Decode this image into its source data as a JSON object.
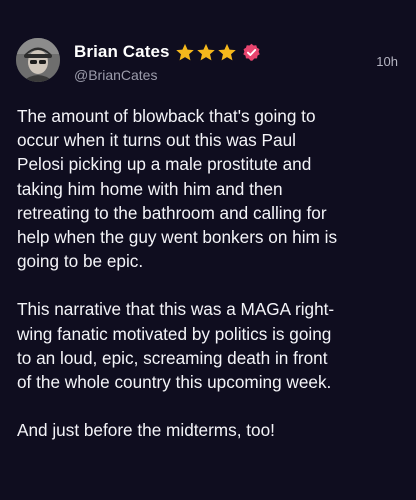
{
  "post": {
    "author": {
      "display_name": "Brian Cates",
      "handle": "@BrianCates",
      "stars_count": 3,
      "star_color": "#f5b81c",
      "verified_color": "#e8456f"
    },
    "timestamp": "10h",
    "paragraphs": [
      "The amount of blowback that's going to\noccur when it turns out this was Paul\nPelosi picking up a male prostitute and\ntaking him home with him and then\nretreating to the bathroom and calling for\nhelp when the guy went bonkers on him is\ngoing to be epic.",
      "This narrative that this was a MAGA right-\nwing fanatic motivated by politics is going\nto an loud, epic, screaming death in front\nof the whole country this upcoming week.",
      "And just before the midterms, too!"
    ]
  },
  "theme": {
    "background": "#0f0d1f",
    "text": "#f4f4f8",
    "muted": "#9c9cab"
  }
}
